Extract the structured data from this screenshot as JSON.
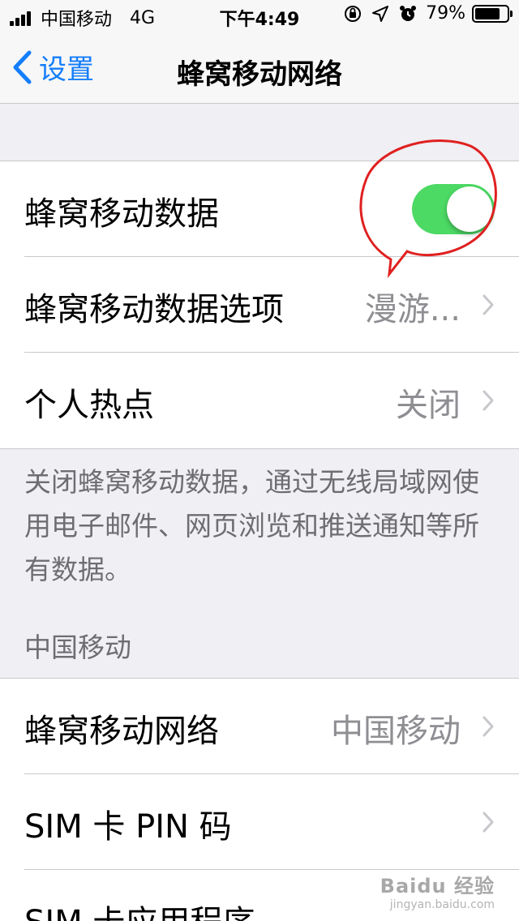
{
  "status_bar": {
    "carrier": "中国移动",
    "network": "4G",
    "time": "下午4:49",
    "battery": "79%",
    "battery_level": 0.79,
    "icons": [
      "signal-icon",
      "orientation-lock-icon",
      "location-icon",
      "alarm-icon",
      "battery-icon"
    ]
  },
  "nav": {
    "back_label": "设置",
    "title": "蜂窝移动网络"
  },
  "group1": {
    "cellular_data_label": "蜂窝移动数据",
    "cellular_data_on": true,
    "options_label": "蜂窝移动数据选项",
    "options_value": "漫游...",
    "hotspot_label": "个人热点",
    "hotspot_value": "关闭"
  },
  "footer_note": "关闭蜂窝移动数据，通过无线局域网使用电子邮件、网页浏览和推送通知等所有数据。",
  "carrier_section": {
    "header": "中国移动",
    "network_label": "蜂窝移动网络",
    "network_value": "中国移动",
    "sim_pin_label": "SIM 卡 PIN 码",
    "sim_apps_label": "SIM 卡应用程序"
  },
  "colors": {
    "accent": "#147efb",
    "toggle_on": "#4cd964",
    "annotation": "#e02020"
  },
  "watermark": {
    "logo": "Baidu 经验",
    "sub": "jingyan.baidu.com"
  }
}
